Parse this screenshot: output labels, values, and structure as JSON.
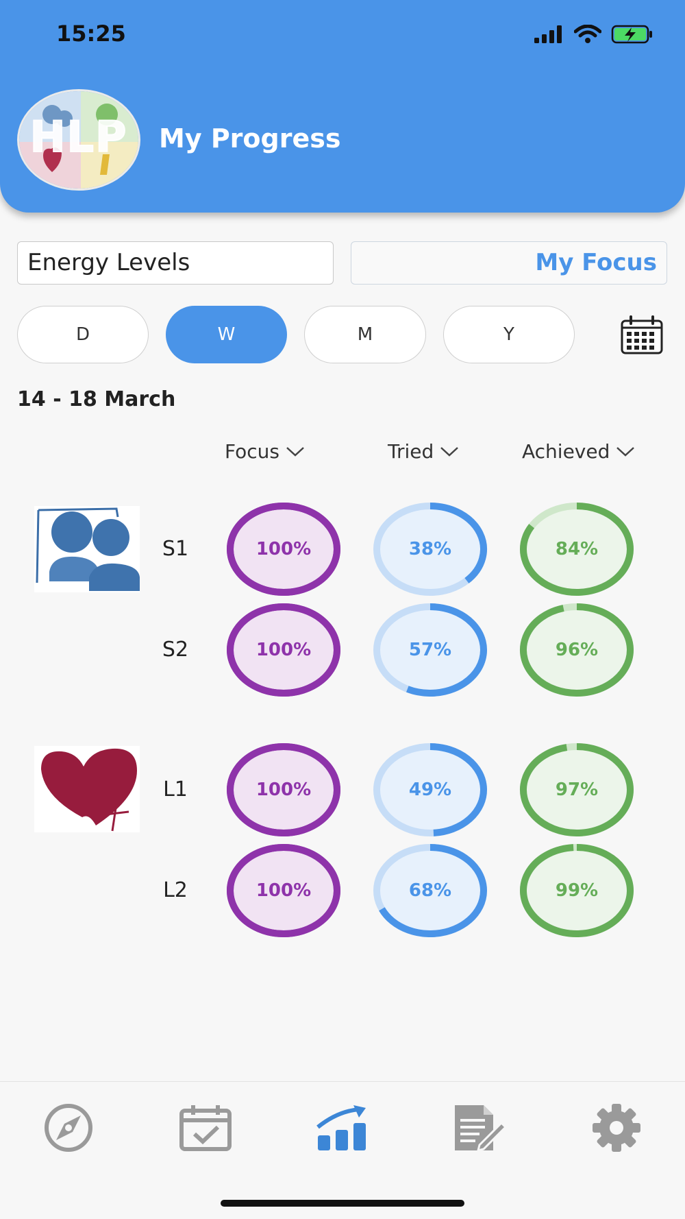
{
  "status": {
    "time": "15:25"
  },
  "header": {
    "title": "My Progress",
    "logo_text": "HLP"
  },
  "filters": {
    "category": "Energy Levels",
    "focus_link": "My Focus"
  },
  "periods": [
    {
      "label": "D",
      "active": false
    },
    {
      "label": "W",
      "active": true
    },
    {
      "label": "M",
      "active": false
    },
    {
      "label": "Y",
      "active": false
    }
  ],
  "date_range": "14 - 18 March",
  "columns": {
    "focus": "Focus",
    "tried": "Tried",
    "achieved": "Achieved"
  },
  "colors": {
    "accent": "#4a94e8",
    "focus": "#8e33aa",
    "focus_bg": "#f1e3f3",
    "tried": "#4a94e8",
    "tried_track": "#c6ddf7",
    "tried_bg": "#e7f1fc",
    "achieved": "#65ad58",
    "achieved_track": "#cfe7ca",
    "achieved_bg": "#ecf5ea"
  },
  "groups": [
    {
      "icon": "people-icon",
      "rows": [
        {
          "label": "S1",
          "focus": 100,
          "tried": 38,
          "achieved": 84,
          "focus_text": "100%",
          "tried_text": "38%",
          "achieved_text": "84%"
        },
        {
          "label": "S2",
          "focus": 100,
          "tried": 57,
          "achieved": 96,
          "focus_text": "100%",
          "tried_text": "57%",
          "achieved_text": "96%"
        }
      ]
    },
    {
      "icon": "heart-icon",
      "rows": [
        {
          "label": "L1",
          "focus": 100,
          "tried": 49,
          "achieved": 97,
          "focus_text": "100%",
          "tried_text": "49%",
          "achieved_text": "97%"
        },
        {
          "label": "L2",
          "focus": 100,
          "tried": 68,
          "achieved": 99,
          "focus_text": "100%",
          "tried_text": "68%",
          "achieved_text": "99%"
        }
      ]
    }
  ],
  "tabs": [
    {
      "icon": "compass-icon",
      "active": false
    },
    {
      "icon": "calendar-check-icon",
      "active": false
    },
    {
      "icon": "progress-chart-icon",
      "active": true
    },
    {
      "icon": "notes-edit-icon",
      "active": false
    },
    {
      "icon": "gear-icon",
      "active": false
    }
  ]
}
